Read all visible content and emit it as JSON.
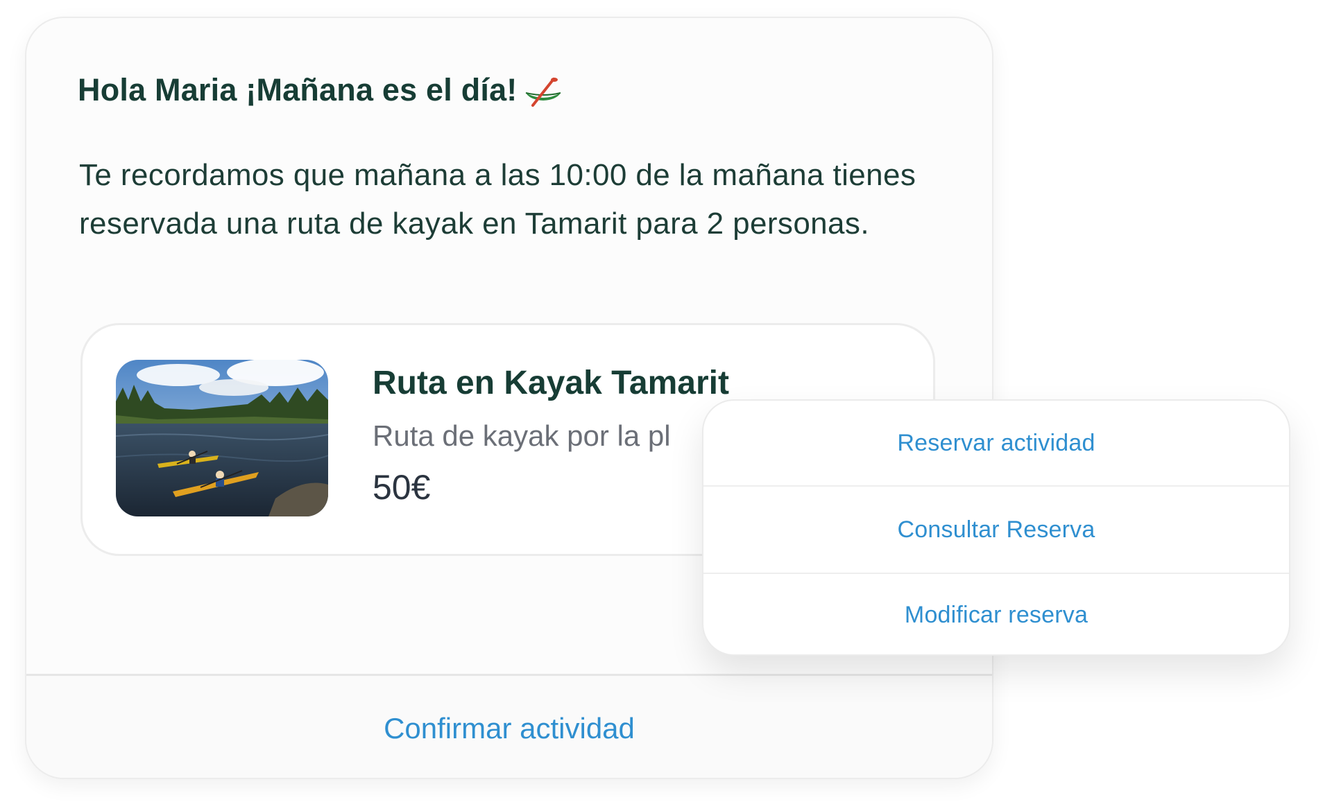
{
  "message": {
    "greeting": "Hola Maria ¡Mañana es el día!",
    "greeting_icon": "canoe-icon",
    "body": "Te recordamos que mañana a las 10:00 de la mañana tienes reservada una ruta de kayak en Tamarit para 2 personas."
  },
  "product": {
    "image": "kayak-river-photo",
    "title": "Ruta en Kayak Tamarit",
    "description": "Ruta de kayak por la pl",
    "price": "50€"
  },
  "footer": {
    "confirm_label": "Confirmar actividad"
  },
  "quick_menu": {
    "items": [
      {
        "label": "Reservar actividad"
      },
      {
        "label": "Consultar Reserva"
      },
      {
        "label": "Modificar reserva"
      }
    ]
  },
  "colors": {
    "heading": "#173d35",
    "link": "#2f8fd0",
    "muted": "#6b6f77",
    "card_bg": "#fcfcfc"
  }
}
